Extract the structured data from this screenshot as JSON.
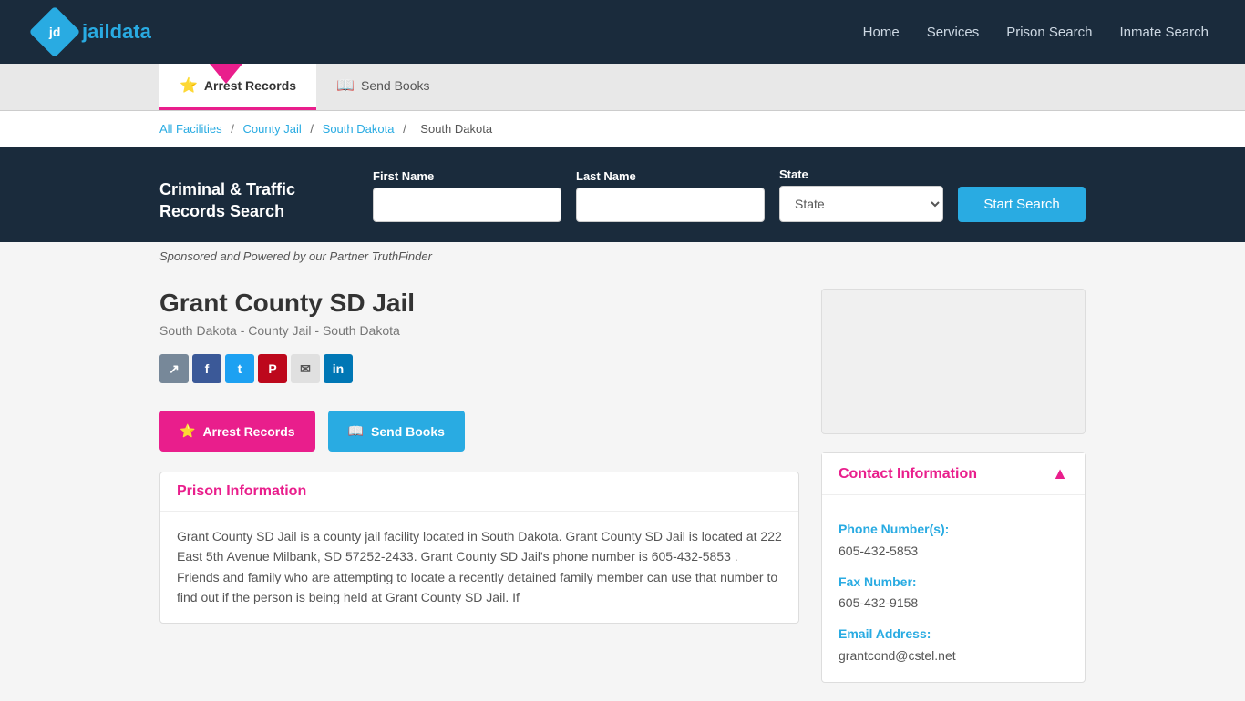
{
  "navbar": {
    "logo_text": "jaildata",
    "logo_initials": "jd",
    "links": [
      {
        "id": "home",
        "label": "Home"
      },
      {
        "id": "services",
        "label": "Services"
      },
      {
        "id": "prison-search",
        "label": "Prison Search"
      },
      {
        "id": "inmate-search",
        "label": "Inmate Search"
      }
    ]
  },
  "sub_nav": {
    "tabs": [
      {
        "id": "arrest-records",
        "label": "Arrest Records",
        "icon": "⭐",
        "active": true
      },
      {
        "id": "send-books",
        "label": "Send Books",
        "icon": "📖",
        "active": false
      }
    ]
  },
  "breadcrumb": {
    "items": [
      {
        "id": "all-facilities",
        "label": "All Facilities",
        "link": true
      },
      {
        "id": "county-jail",
        "label": "County Jail",
        "link": true
      },
      {
        "id": "south-dakota",
        "label": "South Dakota",
        "link": true
      },
      {
        "id": "current",
        "label": "South Dakota",
        "link": false
      }
    ]
  },
  "search": {
    "title": "Criminal & Traffic Records Search",
    "first_name_label": "First Name",
    "first_name_placeholder": "",
    "last_name_label": "Last Name",
    "last_name_placeholder": "",
    "state_label": "State",
    "state_default": "State",
    "button_label": "Start Search"
  },
  "sponsored": {
    "text": "Sponsored and Powered by our Partner TruthFinder"
  },
  "facility": {
    "title": "Grant County SD Jail",
    "subtitle": "South Dakota - County Jail - South Dakota"
  },
  "social": {
    "icons": [
      {
        "id": "share",
        "label": "Share",
        "class": "si-share",
        "symbol": "↗"
      },
      {
        "id": "facebook",
        "label": "f",
        "class": "si-fb",
        "symbol": "f"
      },
      {
        "id": "twitter",
        "label": "t",
        "class": "si-tw",
        "symbol": "t"
      },
      {
        "id": "pinterest",
        "label": "P",
        "class": "si-pin",
        "symbol": "P"
      },
      {
        "id": "email",
        "label": "@",
        "class": "si-email",
        "symbol": "✉"
      },
      {
        "id": "linkedin",
        "label": "in",
        "class": "si-li",
        "symbol": "in"
      }
    ]
  },
  "action_buttons": {
    "arrest_label": "Arrest Records",
    "arrest_icon": "⭐",
    "sendbooks_label": "Send Books",
    "sendbooks_icon": "📖"
  },
  "prison_info": {
    "header": "Prison Information",
    "body": "Grant County SD Jail is a county jail facility located in South Dakota. Grant County SD Jail is located at 222 East 5th Avenue Milbank, SD 57252-2433. Grant County SD Jail's phone number is 605-432-5853 . Friends and family who are attempting to locate a recently detained family member can use that number to find out if the person is being held at Grant County SD Jail. If"
  },
  "contact": {
    "header": "Contact Information",
    "phone_label": "Phone Number(s):",
    "phone_value": "605-432-5853",
    "fax_label": "Fax Number:",
    "fax_value": "605-432-9158",
    "email_label": "Email Address:",
    "email_value": "grantcond@cstel.net"
  }
}
